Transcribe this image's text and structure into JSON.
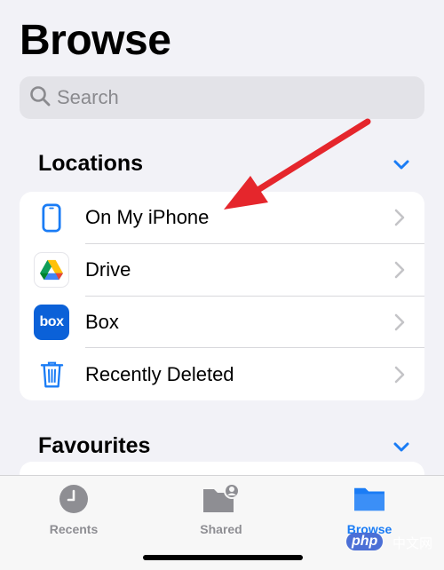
{
  "header": {
    "title": "Browse"
  },
  "search": {
    "placeholder": "Search"
  },
  "sections": {
    "locations": {
      "title": "Locations"
    },
    "favourites": {
      "title": "Favourites"
    }
  },
  "locations": [
    {
      "label": "On My iPhone",
      "icon": "iphone-icon"
    },
    {
      "label": "Drive",
      "icon": "google-drive-icon"
    },
    {
      "label": "Box",
      "icon": "box-icon",
      "logo_text": "box"
    },
    {
      "label": "Recently Deleted",
      "icon": "trash-icon"
    }
  ],
  "tabbar": {
    "recents": {
      "label": "Recents",
      "icon": "clock-icon"
    },
    "shared": {
      "label": "Shared",
      "icon": "shared-folder-icon"
    },
    "browse": {
      "label": "Browse",
      "icon": "folder-icon",
      "active": true
    }
  },
  "watermark": {
    "text": "php",
    "suffix": "中文网"
  },
  "colors": {
    "accent": "#1a7cf5",
    "arrow": "#e5262c",
    "background": "#f2f2f7",
    "inactive": "#8e8e93"
  }
}
